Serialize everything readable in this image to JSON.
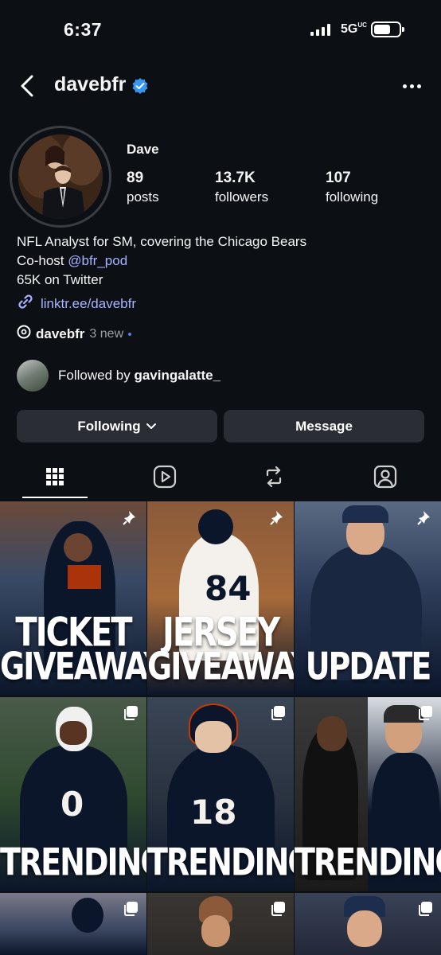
{
  "status_bar": {
    "time": "6:37",
    "network": "5G",
    "network_suffix": "UC"
  },
  "header": {
    "username": "davebfr"
  },
  "profile": {
    "display_name": "Dave",
    "stats": [
      {
        "value": "89",
        "label": "posts"
      },
      {
        "value": "13.7K",
        "label": "followers"
      },
      {
        "value": "107",
        "label": "following"
      }
    ],
    "bio": {
      "line1": "NFL Analyst for SM, covering the Chicago Bears",
      "line2_prefix": "Co-host ",
      "line2_mention": "@bfr_pod",
      "line3": "65K on Twitter"
    },
    "link": "linktr.ee/davebfr",
    "threads": {
      "handle": "davebfr",
      "new_count": "3 new"
    },
    "followed_by": {
      "prefix": "Followed by ",
      "user": "gavingalatte_"
    }
  },
  "actions": {
    "following_label": "Following",
    "message_label": "Message"
  },
  "tabs": [
    "grid-icon",
    "reels-icon",
    "reposts-icon",
    "tagged-icon"
  ],
  "posts": [
    {
      "caption1": "TICKET",
      "caption2": "GIVEAWAY",
      "pinned": true,
      "bg": "#2a3a52"
    },
    {
      "caption1": "JERSEY",
      "caption2": "GIVEAWAY",
      "pinned": true,
      "bg": "#7a4a2a"
    },
    {
      "caption1": "",
      "caption2": "UPDATE",
      "pinned": true,
      "bg": "#2e3d5a"
    },
    {
      "caption1": "",
      "caption2": "TRENDING",
      "pinned": false,
      "bg": "#3a4a3a"
    },
    {
      "caption1": "",
      "caption2": "TRENDING",
      "pinned": false,
      "bg": "#2a3340"
    },
    {
      "caption1": "",
      "caption2": "TRENDING",
      "pinned": false,
      "bg": "#1c1c22"
    },
    {
      "caption1": "",
      "caption2": "",
      "pinned": false,
      "bg": "#3a4560"
    },
    {
      "caption1": "",
      "caption2": "",
      "pinned": false,
      "bg": "#2c2a28"
    },
    {
      "caption1": "",
      "caption2": "",
      "pinned": false,
      "bg": "#222838"
    }
  ],
  "colors": {
    "background": "#0c0f14",
    "link": "#a7b5ff",
    "verified": "#3897f0",
    "button": "#2a2d33",
    "bears_navy": "#0b162a",
    "bears_orange": "#c83803"
  }
}
